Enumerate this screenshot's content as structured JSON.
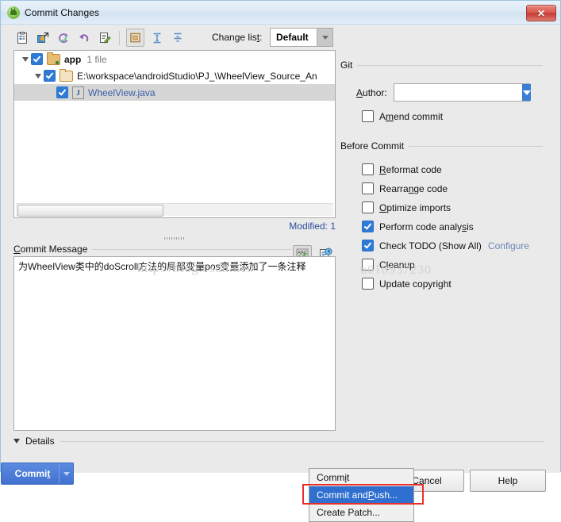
{
  "window": {
    "title": "Commit Changes",
    "app_icon": "android-studio-icon",
    "close_label": "✕"
  },
  "toolbar": {
    "icons": [
      {
        "name": "show-diff-icon",
        "glyph": "▤"
      },
      {
        "name": "revert-selected-icon",
        "glyph": "◩"
      },
      {
        "name": "refresh-icon",
        "glyph": "↻"
      },
      {
        "name": "rollback-icon",
        "glyph": "↶"
      },
      {
        "name": "edit-source-icon",
        "glyph": "✎"
      },
      {
        "name": "group-by-directory-icon",
        "glyph": "▣"
      },
      {
        "name": "expand-all-icon",
        "glyph": "⤒"
      },
      {
        "name": "collapse-all-icon",
        "glyph": "⤓"
      }
    ],
    "changelist_label": "Change list:",
    "changelist_mnemonic": "t",
    "changelist_value": "Default"
  },
  "tree": {
    "rows": [
      {
        "level": 0,
        "expanded": true,
        "checked": true,
        "icon": "folder-module-icon",
        "label": "app",
        "sub": "1 file",
        "bold": true,
        "selected": false,
        "link": false
      },
      {
        "level": 1,
        "expanded": true,
        "checked": true,
        "icon": "folder-icon",
        "label": "E:\\workspace\\androidStudio\\PJ_\\WheelView_Source_An",
        "sub": "",
        "bold": false,
        "selected": false,
        "link": false
      },
      {
        "level": 2,
        "expanded": null,
        "checked": true,
        "icon": "java-file-icon",
        "label": "WheelView.java",
        "sub": "",
        "bold": false,
        "selected": true,
        "link": true
      }
    ],
    "modified_status": "Modified: 1"
  },
  "commit_message": {
    "group_label": "Commit Message",
    "group_mnemonic": "C",
    "text": "为WheelView类中的doScroll方法的局部变量pos变量添加了一条注释",
    "tools": [
      {
        "name": "spellchecker-icon",
        "glyph": "ABC"
      },
      {
        "name": "message-history-icon",
        "glyph": "▤"
      }
    ]
  },
  "details": {
    "label": "Details",
    "expanded": true
  },
  "git_panel": {
    "group_label": "Git",
    "author_label": "Author:",
    "author_mnemonic": "A",
    "author_value": "",
    "author_placeholder": "",
    "amend_label": "Amend commit",
    "amend_checked": false
  },
  "before_commit": {
    "group_label": "Before Commit",
    "items": [
      {
        "label": "Reformat code",
        "checked": false,
        "mnemonic_index": 0
      },
      {
        "label": "Rearrange code",
        "checked": false,
        "mnemonic_index": 7
      },
      {
        "label": "Optimize imports",
        "checked": false,
        "mnemonic_index": 0
      },
      {
        "label": "Perform code analysis",
        "checked": true,
        "mnemonic_index": 18
      },
      {
        "label": "Check TODO (Show All)",
        "checked": true,
        "mnemonic_index": -1,
        "link": "Configure"
      },
      {
        "label": "Cleanup",
        "checked": false,
        "mnemonic_index": 2
      },
      {
        "label": "Update copyright",
        "checked": false,
        "mnemonic_index": -1
      }
    ]
  },
  "footer": {
    "commit_label": "Commit",
    "commit_mnemonic": "t",
    "cancel_label": "Cancel",
    "help_label": "Help"
  },
  "commit_menu": {
    "items": [
      {
        "label": "Commit",
        "active": false,
        "mnemonic": "i"
      },
      {
        "label": "Commit and Push...",
        "active": true,
        "mnemonic": "P"
      },
      {
        "label": "Create Patch...",
        "active": false,
        "mnemonic": ""
      }
    ]
  },
  "watermark": {
    "text_left": "http://blog.csdn.net/",
    "text_right": "u010937230"
  },
  "colors": {
    "accent_blue": "#4272cf",
    "checkbox_blue": "#2e7bd6",
    "highlight_blue": "#2f6fd0",
    "annotation_red": "#e8302a",
    "status_blue": "#2a4b9b",
    "link_gray_blue": "#6b86b5",
    "title_bar": "#ddeaf6",
    "dialog_bg": "#eaeaea"
  }
}
